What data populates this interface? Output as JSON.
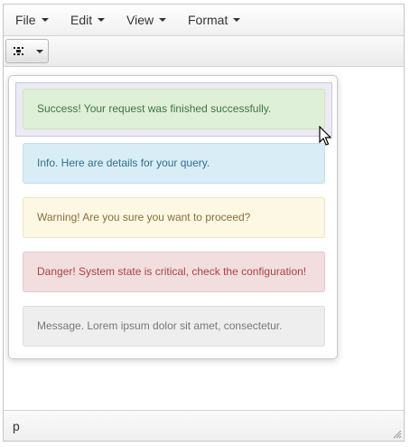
{
  "menubar": {
    "items": [
      {
        "label": "File"
      },
      {
        "label": "Edit"
      },
      {
        "label": "View"
      },
      {
        "label": "Format"
      }
    ]
  },
  "toolbar": {
    "style_button_icon": "template-icon",
    "arrow_icon": "caret-down-icon"
  },
  "dropdown": {
    "alerts": [
      {
        "label": "Success! Your request was finished successfully.",
        "color": "#3c763d"
      },
      {
        "label": "Info. Here are details for your query.",
        "color": "#31708f"
      },
      {
        "label": "Warning! Are you sure you want to proceed?",
        "color": "#8a6d3b"
      },
      {
        "label": "Danger! System state is critical, check the configuration!",
        "color": "#a94442"
      },
      {
        "label": "Message. Lorem ipsum dolor sit amet, consectetur.",
        "color": "#777777"
      }
    ]
  },
  "statusbar": {
    "path": "p"
  }
}
